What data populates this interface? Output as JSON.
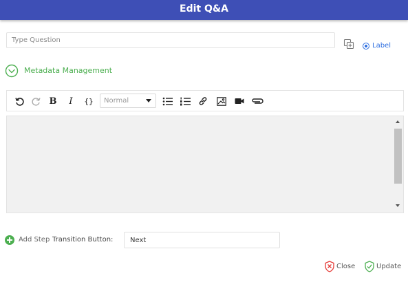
{
  "header": {
    "title": "Edit Q&A"
  },
  "question": {
    "placeholder": "Type Question",
    "value": ""
  },
  "label_option": {
    "label": "Label",
    "selected": true
  },
  "metadata": {
    "label": "Metadata Management"
  },
  "toolbar": {
    "format_select": "Normal",
    "icons": [
      "undo-icon",
      "redo-icon",
      "bold-icon",
      "italic-icon",
      "code-block-icon",
      "bullet-list-icon",
      "ordered-list-icon",
      "link-icon",
      "image-icon",
      "video-icon",
      "attachment-icon"
    ],
    "bold_glyph": "B",
    "italic_glyph": "I",
    "code_glyph": "{}"
  },
  "steps": {
    "add_label": "Add Step",
    "transition_label": "Transition Button:",
    "transition_value": "Next"
  },
  "actions": {
    "close_label": "Close",
    "update_label": "Update"
  },
  "colors": {
    "header": "#3e4fb6",
    "accent_green": "#4caf50",
    "accent_blue": "#2f6fe0",
    "close_red": "#e53935"
  }
}
